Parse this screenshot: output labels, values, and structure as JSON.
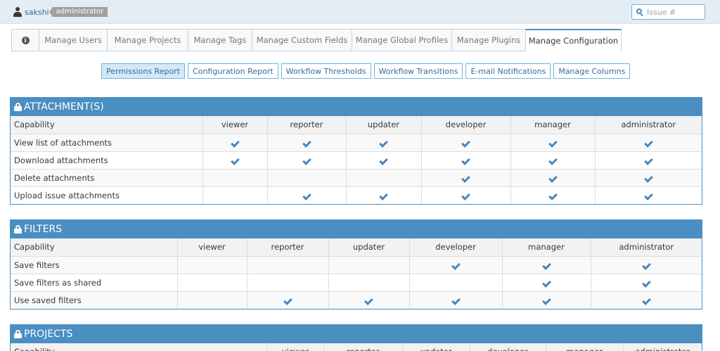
{
  "topbar": {
    "username": "sakshi",
    "role": "administrator",
    "search_placeholder": "Issue #"
  },
  "tabs": [
    {
      "label": "",
      "icon": "info-icon"
    },
    {
      "label": "Manage Users"
    },
    {
      "label": "Manage Projects"
    },
    {
      "label": "Manage Tags"
    },
    {
      "label": "Manage Custom Fields"
    },
    {
      "label": "Manage Global Profiles"
    },
    {
      "label": "Manage Plugins"
    },
    {
      "label": "Manage Configuration",
      "active": true
    }
  ],
  "subnav": [
    {
      "label": "Permissions Report",
      "active": true
    },
    {
      "label": "Configuration Report"
    },
    {
      "label": "Workflow Thresholds"
    },
    {
      "label": "Workflow Transitions"
    },
    {
      "label": "E-mail Notifications"
    },
    {
      "label": "Manage Columns"
    }
  ],
  "sections": [
    {
      "title": "ATTACHMENT(S)",
      "columns": [
        "Capability",
        "viewer",
        "reporter",
        "updater",
        "developer",
        "manager",
        "administrator"
      ],
      "rows": [
        {
          "capability": "View list of attachments",
          "checks": [
            true,
            true,
            true,
            true,
            true,
            true
          ]
        },
        {
          "capability": "Download attachments",
          "checks": [
            true,
            true,
            true,
            true,
            true,
            true
          ]
        },
        {
          "capability": "Delete attachments",
          "checks": [
            false,
            false,
            false,
            true,
            true,
            true
          ]
        },
        {
          "capability": "Upload issue attachments",
          "checks": [
            false,
            true,
            true,
            true,
            true,
            true
          ]
        }
      ]
    },
    {
      "title": "FILTERS",
      "columns": [
        "Capability",
        "viewer",
        "reporter",
        "updater",
        "developer",
        "manager",
        "administrator"
      ],
      "rows": [
        {
          "capability": "Save filters",
          "checks": [
            false,
            false,
            false,
            true,
            true,
            true
          ]
        },
        {
          "capability": "Save filters as shared",
          "checks": [
            false,
            false,
            false,
            false,
            true,
            true
          ]
        },
        {
          "capability": "Use saved filters",
          "checks": [
            false,
            true,
            true,
            true,
            true,
            true
          ]
        }
      ]
    },
    {
      "title": "PROJECTS",
      "columns": [
        "Capability",
        "viewer",
        "reporter",
        "updater",
        "developer",
        "manager",
        "administrator"
      ],
      "rows": []
    }
  ],
  "colors": {
    "accent": "#4a8ec2",
    "check": "#4a86be",
    "link": "#2e6e9e"
  }
}
